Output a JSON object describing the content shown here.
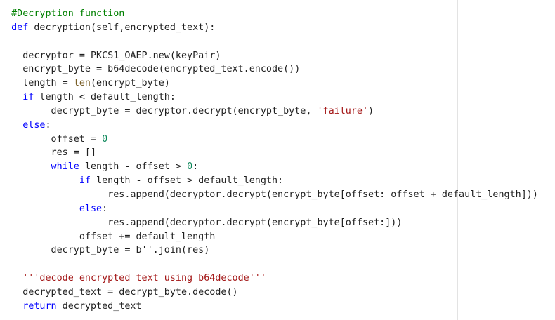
{
  "code": {
    "lines": [
      [
        [
          "comment",
          "  #Decryption function"
        ]
      ],
      [
        [
          "keyword",
          "  def"
        ],
        [
          "plain",
          " decryption(self,encrypted_text):"
        ]
      ],
      [
        [
          "plain",
          ""
        ]
      ],
      [
        [
          "plain",
          "    decryptor = PKCS1_OAEP.new(keyPair)"
        ]
      ],
      [
        [
          "plain",
          "    encrypt_byte = b64decode(encrypted_text.encode())"
        ]
      ],
      [
        [
          "plain",
          "    length = "
        ],
        [
          "builtin",
          "len"
        ],
        [
          "plain",
          "(encrypt_byte)"
        ]
      ],
      [
        [
          "keyword",
          "    if"
        ],
        [
          "plain",
          " length < default_length:"
        ]
      ],
      [
        [
          "plain",
          "         decrypt_byte = decryptor.decrypt(encrypt_byte, "
        ],
        [
          "string",
          "'failure'"
        ],
        [
          "plain",
          ")"
        ]
      ],
      [
        [
          "keyword",
          "    else"
        ],
        [
          "plain",
          ":"
        ]
      ],
      [
        [
          "plain",
          "         offset = "
        ],
        [
          "number",
          "0"
        ]
      ],
      [
        [
          "plain",
          "         res = []"
        ]
      ],
      [
        [
          "keyword",
          "         while"
        ],
        [
          "plain",
          " length - offset > "
        ],
        [
          "number",
          "0"
        ],
        [
          "plain",
          ":"
        ]
      ],
      [
        [
          "keyword",
          "              if"
        ],
        [
          "plain",
          " length - offset > default_length:"
        ]
      ],
      [
        [
          "plain",
          "                   res.append(decryptor.decrypt(encrypt_byte[offset: offset + default_length]))"
        ]
      ],
      [
        [
          "keyword",
          "              else"
        ],
        [
          "plain",
          ":"
        ]
      ],
      [
        [
          "plain",
          "                   res.append(decryptor.decrypt(encrypt_byte[offset:]))"
        ]
      ],
      [
        [
          "plain",
          "              offset += default_length"
        ]
      ],
      [
        [
          "plain",
          "         decrypt_byte = b''.join(res)"
        ]
      ],
      [
        [
          "plain",
          ""
        ]
      ],
      [
        [
          "string",
          "    '''decode encrypted text using b64decode'''"
        ]
      ],
      [
        [
          "plain",
          "    decrypted_text = decrypt_byte.decode()"
        ]
      ],
      [
        [
          "keyword",
          "    return"
        ],
        [
          "plain",
          " decrypted_text"
        ]
      ]
    ]
  },
  "colors": {
    "comment": "#008000",
    "keyword": "#0000ff",
    "builtin": "#795e26",
    "string": "#a31515",
    "number": "#098658",
    "text": "#1f1f1f",
    "background": "#ffffff"
  }
}
